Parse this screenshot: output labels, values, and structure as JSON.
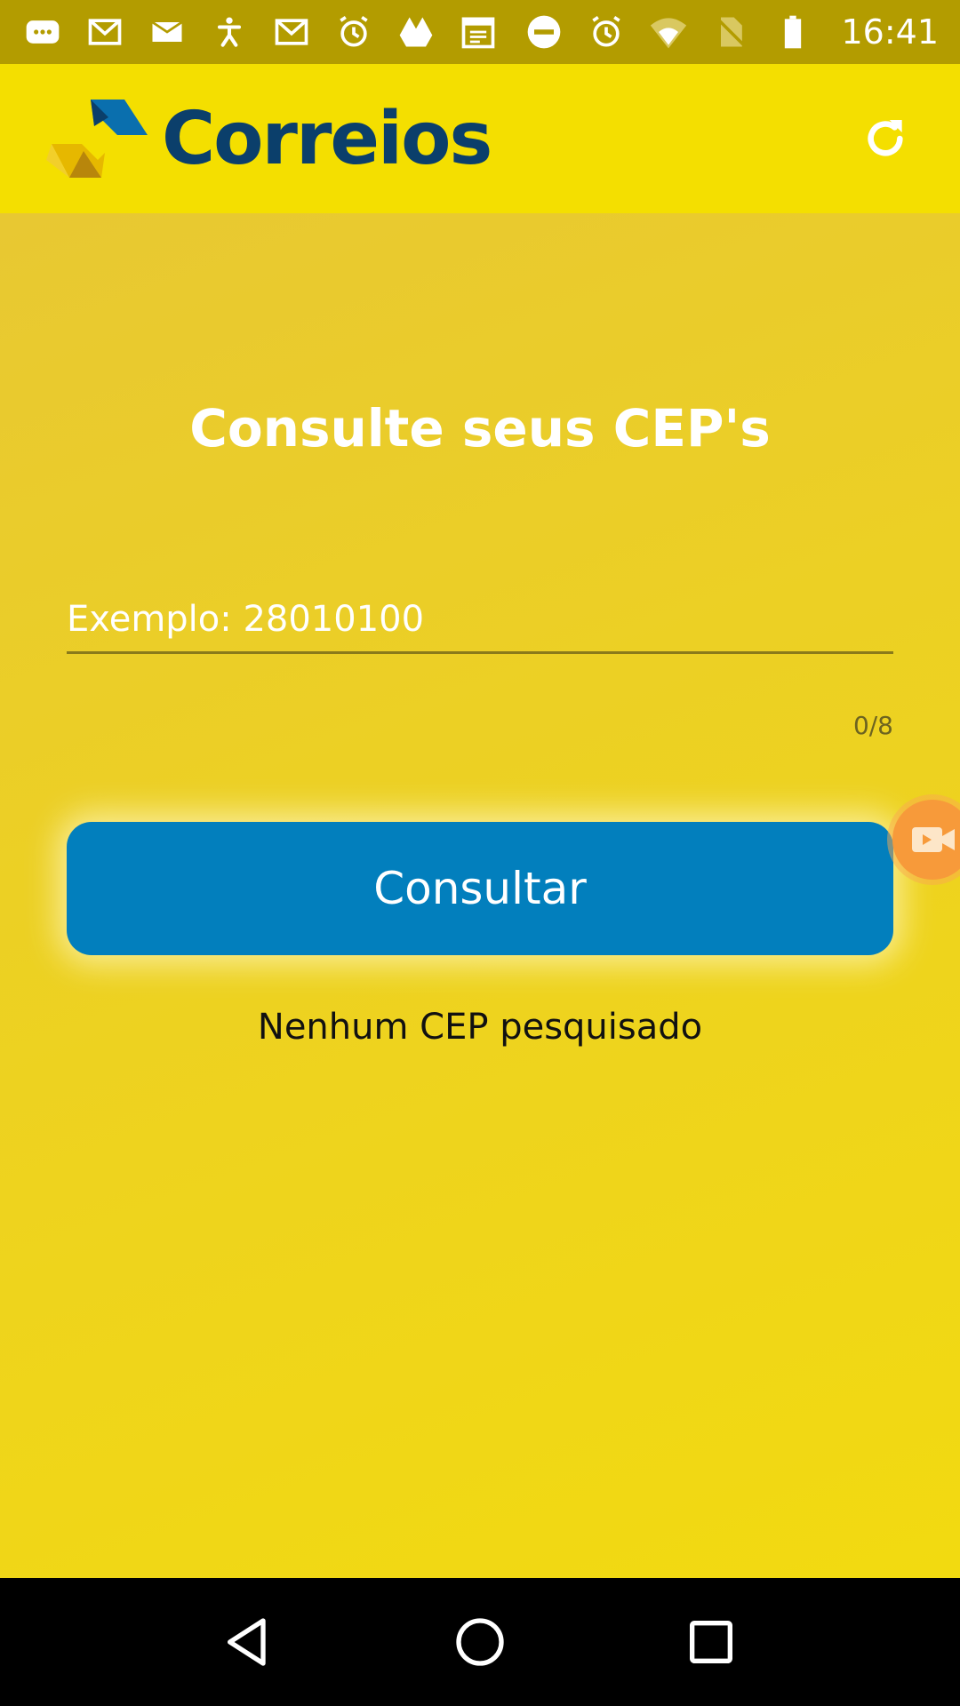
{
  "status_bar": {
    "time": "16:41",
    "left_icons": [
      "chat-icon",
      "gmail-icon",
      "mail-icon",
      "accessibility-icon",
      "gmail-icon",
      "alarm-icon",
      "drive-icon",
      "calendar-icon"
    ],
    "right_icons": [
      "do-not-disturb-icon",
      "alarm-icon",
      "wifi-icon",
      "no-sim-icon",
      "battery-icon"
    ]
  },
  "app_bar": {
    "logo_text": "Correios",
    "refresh_icon": "refresh-icon"
  },
  "main": {
    "title": "Consulte seus CEP's",
    "cep_input": {
      "placeholder": "Exemplo: 28010100",
      "value": "",
      "counter": "0/8"
    },
    "consult_button_label": "Consultar",
    "empty_message": "Nenhum CEP pesquisado"
  },
  "nav_bar": {
    "back_icon": "back-icon",
    "home_icon": "home-icon",
    "recents_icon": "recents-icon"
  },
  "colors": {
    "app_bar_bg": "#f4df00",
    "status_bar_bg": "#b39c00",
    "button_blue": "#027fbd",
    "logo_blue": "#0b3f6b"
  }
}
